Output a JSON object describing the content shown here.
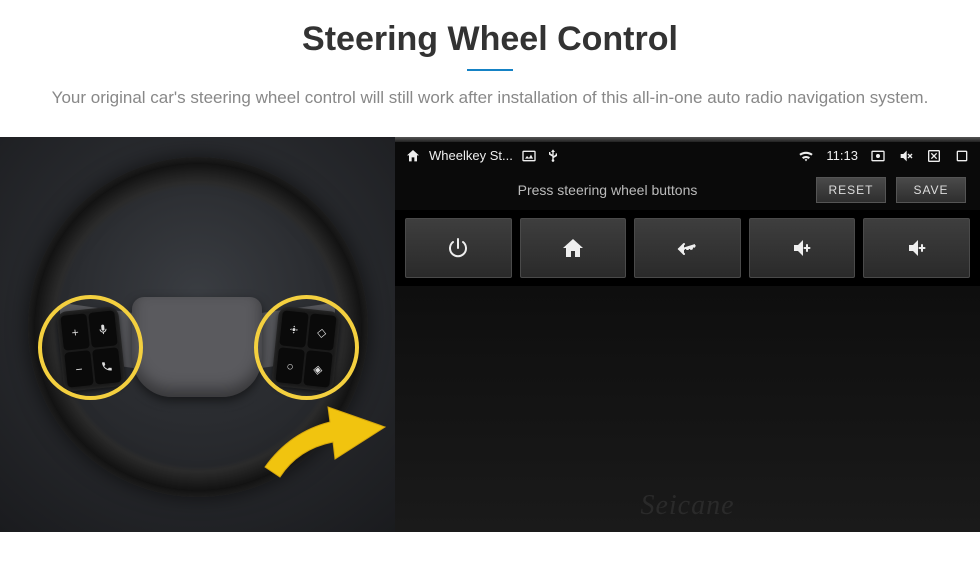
{
  "header": {
    "title": "Steering Wheel Control",
    "description": "Your original car's steering wheel control will still work after installation of this all-in-one auto radio navigation system."
  },
  "wheel": {
    "left_buttons": [
      "plus",
      "voice",
      "minus",
      "phone"
    ],
    "right_buttons": [
      "mode",
      "nav-up",
      "cycle",
      "nav-dot"
    ]
  },
  "stereo": {
    "status": {
      "app_name": "Wheelkey St...",
      "time": "11:13"
    },
    "toolbar": {
      "prompt": "Press steering wheel buttons",
      "reset_label": "RESET",
      "save_label": "SAVE"
    },
    "grid_buttons": [
      {
        "name": "power",
        "icon": "power"
      },
      {
        "name": "home",
        "icon": "home"
      },
      {
        "name": "back",
        "icon": "back"
      },
      {
        "name": "volume-up-1",
        "icon": "vol-up"
      },
      {
        "name": "volume-up-2",
        "icon": "vol-up"
      }
    ],
    "watermark": "Seicane"
  }
}
